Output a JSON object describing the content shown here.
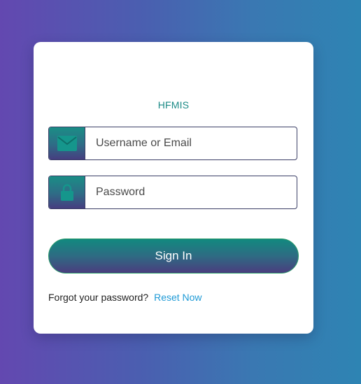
{
  "app": {
    "title": "HFMIS"
  },
  "login": {
    "username_placeholder": "Username or Email",
    "username_value": "",
    "password_placeholder": "Password",
    "password_value": "",
    "signin_label": "Sign In",
    "forgot_text": "Forgot your password?",
    "reset_label": "Reset Now"
  },
  "icons": {
    "username": "envelope-icon",
    "password": "lock-icon"
  },
  "colors": {
    "accent_teal": "#1b8a86",
    "button_gradient_top": "#12897f",
    "button_gradient_bottom": "#4a3d7e",
    "link": "#1e9ad6",
    "background_left": "#6348b0",
    "background_right": "#2e84b3"
  }
}
